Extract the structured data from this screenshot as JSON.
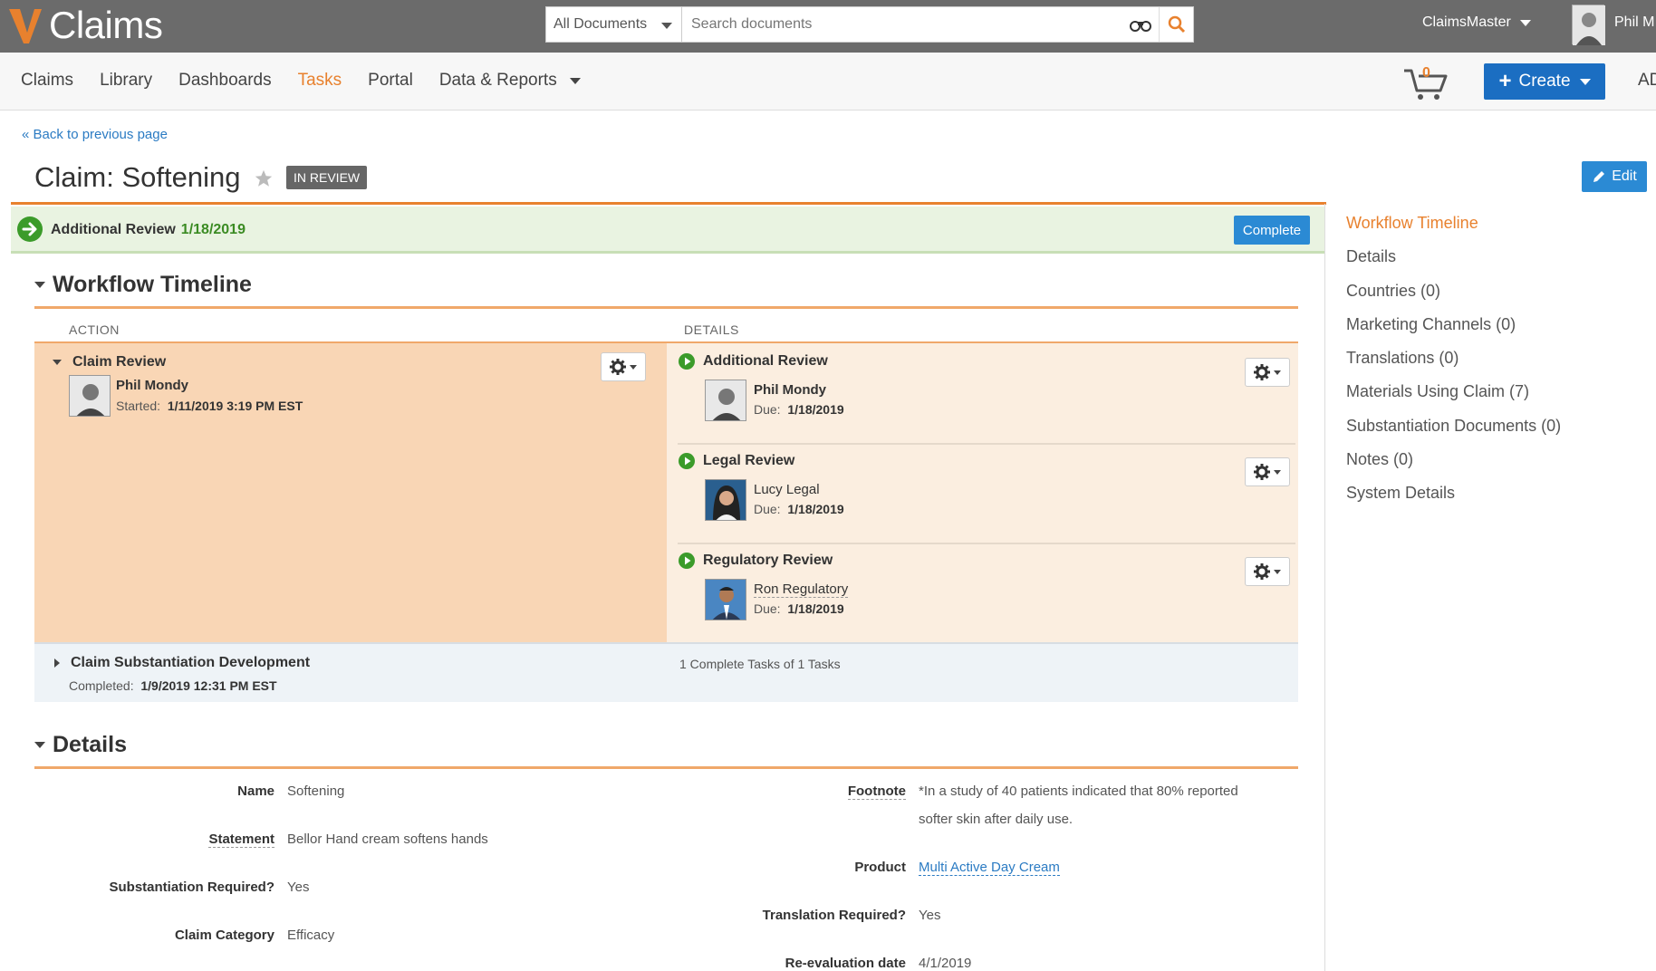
{
  "app": {
    "name": "Claims"
  },
  "search": {
    "scope": "All Documents",
    "placeholder": "Search documents"
  },
  "user": {
    "menu_label": "ClaimsMaster",
    "short_name": "Phil M"
  },
  "nav": {
    "items": [
      {
        "label": "Claims"
      },
      {
        "label": "Library"
      },
      {
        "label": "Dashboards"
      },
      {
        "label": "Tasks",
        "active": true
      },
      {
        "label": "Portal"
      },
      {
        "label": "Data & Reports",
        "dropdown": true
      }
    ],
    "cart_count": "0",
    "create_label": "Create",
    "overflow_label": "AD"
  },
  "back_link": "« Back to previous page",
  "claim": {
    "title": "Claim: Softening",
    "status": "IN REVIEW",
    "edit_label": "Edit"
  },
  "workflow_bar": {
    "step": "Additional Review",
    "date": "1/18/2019",
    "complete_label": "Complete"
  },
  "workflow_timeline": {
    "heading": "Workflow Timeline",
    "col_action": "ACTION",
    "col_details": "DETAILS",
    "claim_review": {
      "title": "Claim Review",
      "person": "Phil Mondy",
      "started_label": "Started:",
      "started_value": "1/11/2019 3:19 PM EST"
    },
    "tasks": [
      {
        "title": "Additional Review",
        "person": "Phil Mondy",
        "due_label": "Due:",
        "due_value": "1/18/2019"
      },
      {
        "title": "Legal Review",
        "person": "Lucy Legal",
        "due_label": "Due:",
        "due_value": "1/18/2019"
      },
      {
        "title": "Regulatory Review",
        "person": "Ron Regulatory",
        "due_label": "Due:",
        "due_value": "1/18/2019"
      }
    ],
    "substantiation": {
      "title": "Claim Substantiation Development",
      "completed_label": "Completed:",
      "completed_value": "1/9/2019 12:31 PM EST",
      "tasks_summary": "1 Complete Tasks of 1 Tasks"
    }
  },
  "details": {
    "heading": "Details",
    "left": [
      {
        "label": "Name",
        "value": "Softening"
      },
      {
        "label": "Statement",
        "value": "Bellor Hand cream softens hands"
      },
      {
        "label": "Substantiation Required?",
        "value": "Yes"
      },
      {
        "label": "Claim Category",
        "value": "Efficacy"
      }
    ],
    "right": [
      {
        "label": "Footnote",
        "value_line1": "*In a study of 40 patients indicated that 80% reported",
        "value_line2": "softer skin after daily use."
      },
      {
        "label": "Product",
        "value": "Multi Active Day Cream"
      },
      {
        "label": "Translation Required?",
        "value": "Yes"
      },
      {
        "label": "Re-evaluation date",
        "value": "4/1/2019"
      }
    ]
  },
  "side_nav": {
    "items": [
      {
        "label": "Workflow Timeline",
        "active": true
      },
      {
        "label": "Details"
      },
      {
        "label": "Countries (0)"
      },
      {
        "label": "Marketing Channels (0)"
      },
      {
        "label": "Translations (0)"
      },
      {
        "label": "Materials Using Claim (7)"
      },
      {
        "label": "Substantiation Documents (0)"
      },
      {
        "label": "Notes (0)"
      },
      {
        "label": "System Details"
      }
    ]
  },
  "colors": {
    "accent_orange": "#e8812e",
    "primary_blue": "#1b6ec2",
    "success_green": "#3b8b23",
    "topbar_gray": "#6b6b6b"
  },
  "icons": {
    "logo": "v-logo-icon",
    "search": "search-icon",
    "binoculars": "binoculars-icon",
    "cart": "cart-icon",
    "star": "star-icon",
    "edit": "pencil-icon",
    "gear": "gear-icon",
    "play": "play-circle-icon",
    "arrow": "arrow-circle-icon"
  }
}
